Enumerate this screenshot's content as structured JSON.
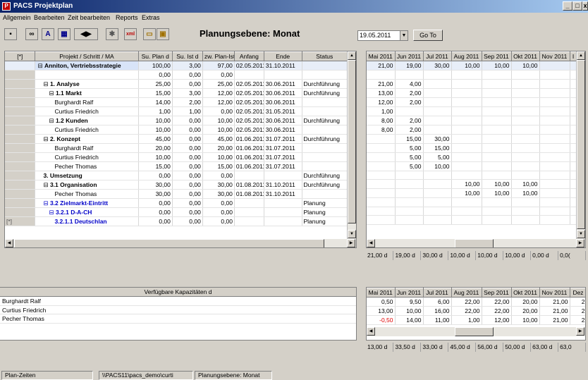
{
  "window": {
    "title": "PACS Projektplan"
  },
  "menu": [
    "Allgemein",
    "Bearbeiten",
    "Zeit bearbeiten",
    "Reports",
    "Extras"
  ],
  "toolbar": {
    "title": "Planungsebene: Monat",
    "date": "19.05.2011",
    "goto_label": "Go To",
    "xml_label": "xml"
  },
  "plan_table": {
    "headers": [
      "[*]",
      "Projekt / Schritt / MA",
      "Su. Plan d",
      "Su. Ist d",
      "zw. Plan-Ist",
      "Anfang",
      "Ende",
      "Status"
    ],
    "rows": [
      {
        "marker": "",
        "name": "Anniton, Vertriebsstrategie",
        "plan": "100,00",
        "ist": "3,00",
        "diff": "97,00",
        "start": "02.05.2011",
        "end": "31.10.2011",
        "status": ""
      },
      {
        "marker": "",
        "name": "",
        "plan": "0,00",
        "ist": "0,00",
        "diff": "0,00",
        "start": "",
        "end": "",
        "status": ""
      },
      {
        "marker": "",
        "name": "1. Analyse",
        "plan": "25,00",
        "ist": "0,00",
        "diff": "25,00",
        "start": "02.05.2011",
        "end": "30.06.2011",
        "status": "Durchführung"
      },
      {
        "marker": "",
        "name": "1.1 Markt",
        "plan": "15,00",
        "ist": "3,00",
        "diff": "12,00",
        "start": "02.05.2011",
        "end": "30.06.2011",
        "status": "Durchführung"
      },
      {
        "marker": "",
        "name": "Burghardt Ralf",
        "plan": "14,00",
        "ist": "2,00",
        "diff": "12,00",
        "start": "02.05.2011",
        "end": "30.06.2011",
        "status": ""
      },
      {
        "marker": "",
        "name": "Curtius Friedrich",
        "plan": "1,00",
        "ist": "1,00",
        "diff": "0,00",
        "start": "02.05.2011",
        "end": "31.05.2011",
        "status": ""
      },
      {
        "marker": "",
        "name": "1.2 Kunden",
        "plan": "10,00",
        "ist": "0,00",
        "diff": "10,00",
        "start": "02.05.2011",
        "end": "30.06.2011",
        "status": "Durchführung"
      },
      {
        "marker": "",
        "name": "Curtius Friedrich",
        "plan": "10,00",
        "ist": "0,00",
        "diff": "10,00",
        "start": "02.05.2011",
        "end": "30.06.2011",
        "status": ""
      },
      {
        "marker": "",
        "name": "2. Konzept",
        "plan": "45,00",
        "ist": "0,00",
        "diff": "45,00",
        "start": "01.06.2011",
        "end": "31.07.2011",
        "status": "Durchführung"
      },
      {
        "marker": "",
        "name": "Burghardt Ralf",
        "plan": "20,00",
        "ist": "0,00",
        "diff": "20,00",
        "start": "01.06.2011",
        "end": "31.07.2011",
        "status": ""
      },
      {
        "marker": "",
        "name": "Curtius Friedrich",
        "plan": "10,00",
        "ist": "0,00",
        "diff": "10,00",
        "start": "01.06.2011",
        "end": "31.07.2011",
        "status": ""
      },
      {
        "marker": "",
        "name": "Pecher Thomas",
        "plan": "15,00",
        "ist": "0,00",
        "diff": "15,00",
        "start": "01.06.2011",
        "end": "31.07.2011",
        "status": ""
      },
      {
        "marker": "",
        "name": "3. Umsetzung",
        "plan": "0,00",
        "ist": "0,00",
        "diff": "0,00",
        "start": "",
        "end": "",
        "status": "Durchführung"
      },
      {
        "marker": "",
        "name": "3.1 Organisation",
        "plan": "30,00",
        "ist": "0,00",
        "diff": "30,00",
        "start": "01.08.2011",
        "end": "31.10.2011",
        "status": "Durchführung"
      },
      {
        "marker": "",
        "name": "Pecher Thomas",
        "plan": "30,00",
        "ist": "0,00",
        "diff": "30,00",
        "start": "01.08.2011",
        "end": "31.10.2011",
        "status": ""
      },
      {
        "marker": "",
        "name": "3.2 Zielmarkt-Eintritt",
        "plan": "0,00",
        "ist": "0,00",
        "diff": "0,00",
        "start": "",
        "end": "",
        "status": "Planung"
      },
      {
        "marker": "",
        "name": "3.2.1 D-A-CH",
        "plan": "0,00",
        "ist": "0,00",
        "diff": "0,00",
        "start": "",
        "end": "",
        "status": "Planung"
      },
      {
        "marker": "[*]",
        "name": "3.2.1.1 Deutschlan",
        "plan": "0,00",
        "ist": "0,00",
        "diff": "0,00",
        "start": "",
        "end": "",
        "status": "Planung"
      }
    ]
  },
  "month_table": {
    "headers": [
      "Mai 2011",
      "Jun 2011",
      "Jul 2011",
      "Aug 2011",
      "Sep 2011",
      "Okt 2011",
      "Nov 2011",
      "I"
    ],
    "rows": [
      [
        "21,00",
        "19,00",
        "30,00",
        "10,00",
        "10,00",
        "10,00",
        "",
        ""
      ],
      [
        "",
        "",
        "",
        "",
        "",
        "",
        "",
        ""
      ],
      [
        "21,00",
        "4,00",
        "",
        "",
        "",
        "",
        "",
        ""
      ],
      [
        "13,00",
        "2,00",
        "",
        "",
        "",
        "",
        "",
        ""
      ],
      [
        "12,00",
        "2,00",
        "",
        "",
        "",
        "",
        "",
        ""
      ],
      [
        "1,00",
        "",
        "",
        "",
        "",
        "",
        "",
        ""
      ],
      [
        "8,00",
        "2,00",
        "",
        "",
        "",
        "",
        "",
        ""
      ],
      [
        "8,00",
        "2,00",
        "",
        "",
        "",
        "",
        "",
        ""
      ],
      [
        "",
        "15,00",
        "30,00",
        "",
        "",
        "",
        "",
        ""
      ],
      [
        "",
        "5,00",
        "15,00",
        "",
        "",
        "",
        "",
        ""
      ],
      [
        "",
        "5,00",
        "5,00",
        "",
        "",
        "",
        "",
        ""
      ],
      [
        "",
        "5,00",
        "10,00",
        "",
        "",
        "",
        "",
        ""
      ],
      [
        "",
        "",
        "",
        "",
        "",
        "",
        "",
        ""
      ],
      [
        "",
        "",
        "",
        "10,00",
        "10,00",
        "10,00",
        "",
        ""
      ],
      [
        "",
        "",
        "",
        "10,00",
        "10,00",
        "10,00",
        "",
        ""
      ],
      [
        "",
        "",
        "",
        "",
        "",
        "",
        "",
        ""
      ],
      [
        "",
        "",
        "",
        "",
        "",
        "",
        "",
        ""
      ],
      [
        "",
        "",
        "",
        "",
        "",
        "",
        "",
        ""
      ]
    ],
    "totals": [
      "21,00 d",
      "19,00 d",
      "30,00 d",
      "10,00 d",
      "10,00 d",
      "10,00 d",
      "0,00 d",
      "0,0("
    ]
  },
  "capacity": {
    "header": "Verfügbare Kapazitäten d",
    "people": [
      "Burghardt Ralf",
      "Curtius Friedrich",
      "Pecher Thomas"
    ],
    "months": [
      "Mai 2011",
      "Jun 2011",
      "Jul 2011",
      "Aug 2011",
      "Sep 2011",
      "Okt 2011",
      "Nov 2011",
      "Dez"
    ],
    "rows": [
      [
        "0,50",
        "9,50",
        "6,00",
        "22,00",
        "22,00",
        "20,00",
        "21,00",
        "2"
      ],
      [
        "13,00",
        "10,00",
        "16,00",
        "22,00",
        "22,00",
        "20,00",
        "21,00",
        "2"
      ],
      [
        "-0,50",
        "14,00",
        "11,00",
        "1,00",
        "12,00",
        "10,00",
        "21,00",
        "2"
      ]
    ],
    "totals": [
      "13,00 d",
      "33,50 d",
      "33,00 d",
      "45,00 d",
      "56,00 d",
      "50,00 d",
      "63,00 d",
      "63,0"
    ]
  },
  "status": {
    "left": "Plan-Zeiten",
    "path": "\\\\PACS11\\pacs_demo\\curti",
    "level": "Planungsebene: Monat"
  }
}
